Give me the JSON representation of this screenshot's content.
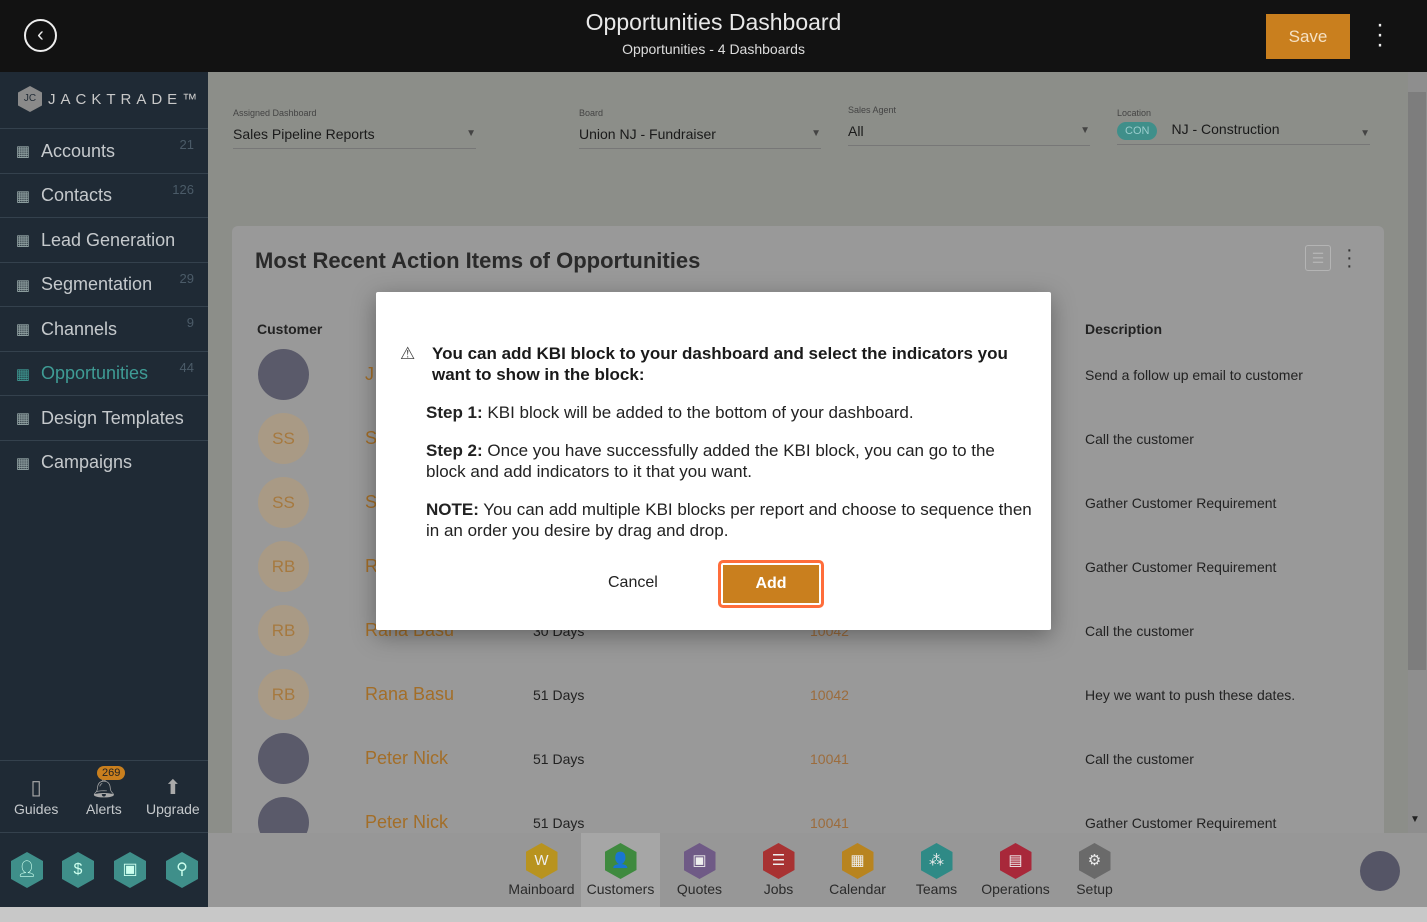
{
  "header": {
    "title": "Opportunities Dashboard",
    "subtitle": "Opportunities - 4 Dashboards",
    "save_label": "Save"
  },
  "sidebar": {
    "logo": "JACKTRADE™",
    "items": [
      {
        "label": "Accounts",
        "count": "21",
        "icon": "building-icon"
      },
      {
        "label": "Contacts",
        "count": "126",
        "icon": "contacts-icon"
      },
      {
        "label": "Lead Generation",
        "count": "",
        "icon": "network-icon"
      },
      {
        "label": "Segmentation",
        "count": "29",
        "icon": "segmentation-icon"
      },
      {
        "label": "Channels",
        "count": "9",
        "icon": "channels-icon"
      },
      {
        "label": "Opportunities",
        "count": "44",
        "icon": "opportunities-icon"
      },
      {
        "label": "Design Templates",
        "count": "",
        "icon": "templates-icon"
      },
      {
        "label": "Campaigns",
        "count": "",
        "icon": "campaigns-icon"
      }
    ],
    "tools": {
      "guides": "Guides",
      "alerts": "Alerts",
      "alerts_count": "269",
      "upgrade": "Upgrade"
    }
  },
  "filters": {
    "assigned_dashboard": {
      "label": "Assigned Dashboard",
      "value": "Sales Pipeline Reports"
    },
    "board": {
      "label": "Board",
      "value": "Union NJ - Fundraiser"
    },
    "sales_agent": {
      "label": "Sales Agent",
      "value": "All"
    },
    "location": {
      "label": "Location",
      "badge": "CON",
      "value": "NJ - Construction"
    }
  },
  "card": {
    "title": "Most Recent Action Items of Opportunities",
    "columns": {
      "customer": "Customer",
      "description": "Description"
    },
    "rows": [
      {
        "initials": "",
        "name": "J",
        "days": "",
        "id": "",
        "description": "Send a follow up email to customer",
        "photo": true
      },
      {
        "initials": "SS",
        "name": "S",
        "days": "",
        "id": "",
        "description": "Call the customer"
      },
      {
        "initials": "SS",
        "name": "S",
        "days": "",
        "id": "",
        "description": "Gather Customer Requirement"
      },
      {
        "initials": "RB",
        "name": "R",
        "days": "",
        "id": "",
        "description": "Gather Customer Requirement"
      },
      {
        "initials": "RB",
        "name": "Rana Basu",
        "days": "30 Days",
        "id": "10042",
        "description": "Call the customer"
      },
      {
        "initials": "RB",
        "name": "Rana Basu",
        "days": "51 Days",
        "id": "10042",
        "description": "Hey we want to push these dates."
      },
      {
        "initials": "",
        "name": "Peter Nick",
        "days": "51 Days",
        "id": "10041",
        "description": "Call the customer",
        "photo": true
      },
      {
        "initials": "",
        "name": "Peter Nick",
        "days": "51 Days",
        "id": "10041",
        "description": "Gather Customer Requirement",
        "photo": true
      }
    ]
  },
  "bottom_nav": [
    {
      "label": "Mainboard",
      "color": "#b8931f",
      "glyph": "W"
    },
    {
      "label": "Customers",
      "color": "#3f8a3f",
      "glyph": "👤",
      "selected": true
    },
    {
      "label": "Quotes",
      "color": "#6f5a86",
      "glyph": "▣"
    },
    {
      "label": "Jobs",
      "color": "#a83232",
      "glyph": "☰"
    },
    {
      "label": "Calendar",
      "color": "#b8841f",
      "glyph": "▦"
    },
    {
      "label": "Teams",
      "color": "#2f8a86",
      "glyph": "⁂"
    },
    {
      "label": "Operations",
      "color": "#a8283a",
      "glyph": "▤"
    },
    {
      "label": "Setup",
      "color": "#6a6a6a",
      "glyph": "⚙"
    }
  ],
  "modal": {
    "heading": "You can add KBI block to your dashboard and select the indicators you want to show in the block:",
    "step1_label": "Step 1:",
    "step1": " KBI block will be added to the bottom of your dashboard.",
    "step2_label": "Step 2:",
    "step2": " Once you have successfully added the KBI block, you can go to the block and add indicators to it that you want.",
    "note_label": "NOTE:",
    "note": " You can add multiple KBI blocks per report and choose to sequence then in an order you desire by drag and drop.",
    "cancel_label": "Cancel",
    "add_label": "Add"
  }
}
